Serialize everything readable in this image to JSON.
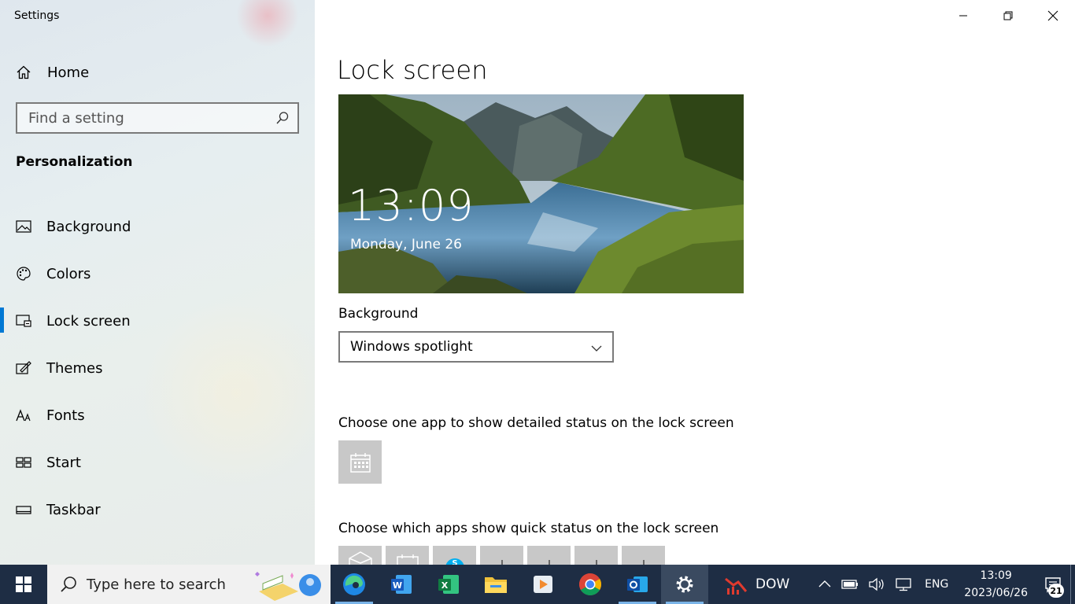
{
  "window": {
    "title": "Settings"
  },
  "sidebar": {
    "home_label": "Home",
    "search_placeholder": "Find a setting",
    "section_title": "Personalization",
    "items": [
      {
        "label": "Background",
        "icon": "picture-icon"
      },
      {
        "label": "Colors",
        "icon": "palette-icon"
      },
      {
        "label": "Lock screen",
        "icon": "lock-screen-icon",
        "active": true
      },
      {
        "label": "Themes",
        "icon": "themes-icon"
      },
      {
        "label": "Fonts",
        "icon": "fonts-icon"
      },
      {
        "label": "Start",
        "icon": "start-icon"
      },
      {
        "label": "Taskbar",
        "icon": "taskbar-icon"
      }
    ]
  },
  "main": {
    "title": "Lock screen",
    "preview": {
      "time": "13:09",
      "date": "Monday, June 26"
    },
    "background_label": "Background",
    "background_value": "Windows spotlight",
    "detailed_status_label": "Choose one app to show detailed status on the lock screen",
    "quick_status_label": "Choose which apps show quick status on the lock screen"
  },
  "taskbar": {
    "search_placeholder": "Type here to search",
    "apps": [
      "edge-icon",
      "word-icon",
      "excel-icon",
      "file-explorer-icon",
      "media-player-icon",
      "chrome-icon",
      "outlook-icon",
      "settings-icon"
    ],
    "dow_label": "DOW",
    "language": "ENG",
    "clock_time": "13:09",
    "clock_date": "2023/06/26",
    "notification_count": "21"
  },
  "colors": {
    "accent": "#0078d4",
    "taskbar": "#1e2d44",
    "tile": "#c8c8c8"
  }
}
